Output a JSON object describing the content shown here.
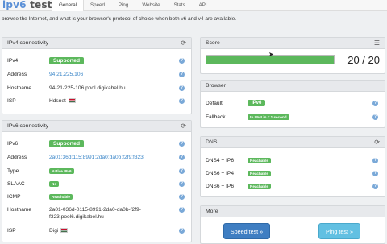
{
  "app": {
    "logo_prefix": "ipv6",
    "logo_suffix": " test"
  },
  "tabs": [
    {
      "label": "General"
    },
    {
      "label": "Speed"
    },
    {
      "label": "Ping"
    },
    {
      "label": "Website"
    },
    {
      "label": "Stats"
    },
    {
      "label": "API"
    }
  ],
  "intro": {
    "line2": "browse the Internet, and what is your browser's protocol of choice when both v6 and v4 are available.",
    "line1_tail": "( ... )"
  },
  "ipv4": {
    "title": "IPv4 connectivity",
    "rows": [
      {
        "label": "IPv4",
        "value": "Supported"
      },
      {
        "label": "Address",
        "value": "94.21.225.106"
      },
      {
        "label": "Hostname",
        "value": "94-21-225-106.pool.digikabel.hu"
      },
      {
        "label": "ISP",
        "value": "Hdsnet"
      }
    ]
  },
  "ipv6": {
    "title": "IPv6 connectivity",
    "rows": [
      {
        "label": "IPv6",
        "value": "Supported"
      },
      {
        "label": "Address",
        "value": "2a01:36d:115:8991:2da0:da0b:f2f9:f323"
      },
      {
        "label": "Type",
        "value": "Native IPv6"
      },
      {
        "label": "SLAAC",
        "value": "No"
      },
      {
        "label": "ICMP",
        "value": "Reachable"
      },
      {
        "label": "Hostname",
        "value_line1": "2a01-036d-0115-8991-2da0-da0b-f2f9-",
        "value_line2": "f323.pool6.digikabel.hu"
      },
      {
        "label": "ISP",
        "value": "Digi"
      }
    ]
  },
  "score": {
    "title": "Score",
    "value": "20 / 20",
    "fraction": 1.0
  },
  "browser": {
    "title": "Browser",
    "rows": [
      {
        "label": "Default",
        "value": "IPv6"
      },
      {
        "label": "Fallback",
        "value": "to IPv4 in < 1 second"
      }
    ]
  },
  "dns": {
    "title": "DNS",
    "rows": [
      {
        "label": "DNS4 + IP6",
        "value": "Reachable"
      },
      {
        "label": "DNS6 + IP4",
        "value": "Reachable"
      },
      {
        "label": "DNS6 + IP6",
        "value": "Reachable"
      }
    ]
  },
  "more": {
    "title": "More",
    "speed_button": "Speed test »",
    "ping_button": "Ping test »"
  },
  "help_glyph": "?",
  "colors": {
    "success": "#5cb85c",
    "link": "#3b86c8",
    "primary_button": "#3f7ec2",
    "info_button": "#62c0e2"
  }
}
